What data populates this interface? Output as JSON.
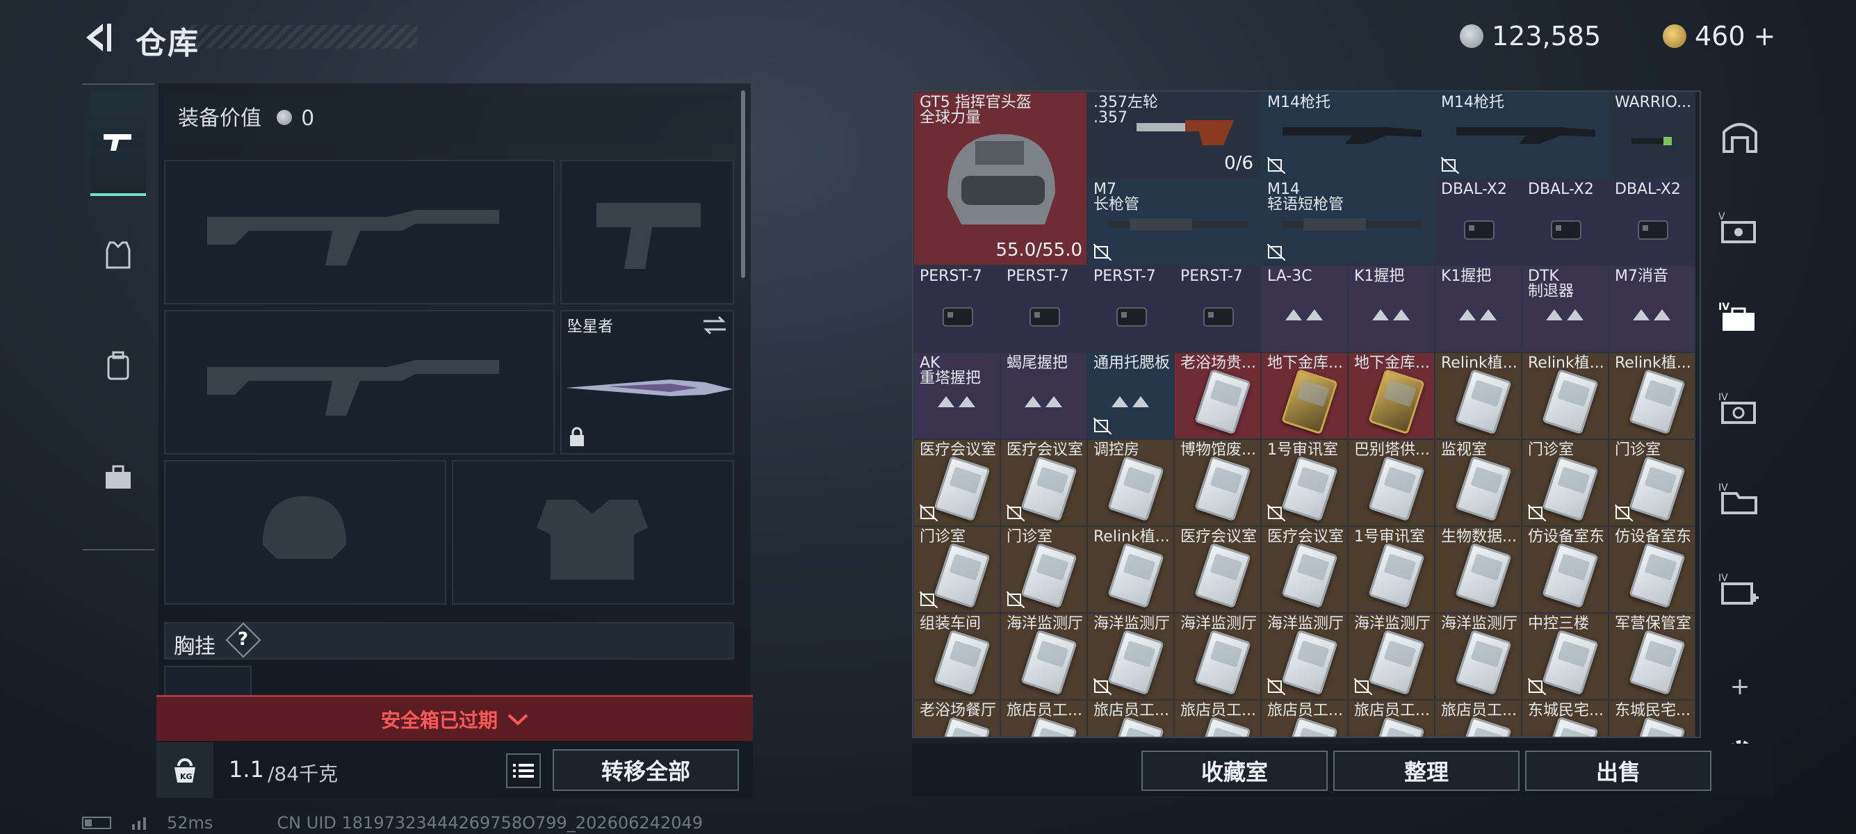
{
  "header": {
    "title": "仓库",
    "currency_silver": "123,585",
    "currency_gold": "460",
    "add_symbol": "+"
  },
  "left": {
    "equip_value_label": "装备价值",
    "equip_value": "0",
    "melee_name": "坠星者",
    "chest_label": "胸挂",
    "chest_help": "?",
    "safe_box_status": "安全箱已过期",
    "weight_current": "1.1",
    "weight_max": "/84千克",
    "transfer_all": "转移全部"
  },
  "inventory": {
    "helmet": {
      "name1": "GT5 指挥官头盔",
      "name2": "全球力量",
      "durability": "55.0/55.0"
    },
    "revolver": {
      "name1": ".357左轮",
      "name2": ".357",
      "count": "0/6"
    },
    "cells": [
      {
        "id": "m14stock1",
        "l1": "M14枪托",
        "l2": ""
      },
      {
        "id": "m14stock2",
        "l1": "M14枪托",
        "l2": ""
      },
      {
        "id": "warrior",
        "l1": "WARRIO...",
        "l2": ""
      },
      {
        "id": "m7barrel",
        "l1": "M7",
        "l2": "长枪管"
      },
      {
        "id": "m14barrel",
        "l1": "M14",
        "l2": "轻语短枪管"
      },
      {
        "id": "dbal1",
        "l1": "DBAL-X2",
        "l2": ""
      },
      {
        "id": "dbal2",
        "l1": "DBAL-X2",
        "l2": ""
      },
      {
        "id": "dbal3",
        "l1": "DBAL-X2",
        "l2": ""
      },
      {
        "id": "perst1",
        "l1": "PERST-7",
        "l2": ""
      },
      {
        "id": "perst2",
        "l1": "PERST-7",
        "l2": ""
      },
      {
        "id": "perst3",
        "l1": "PERST-7",
        "l2": ""
      },
      {
        "id": "perst4",
        "l1": "PERST-7",
        "l2": ""
      },
      {
        "id": "la3c",
        "l1": "LA-3C",
        "l2": ""
      },
      {
        "id": "k1a",
        "l1": "K1握把",
        "l2": ""
      },
      {
        "id": "k1b",
        "l1": "K1握把",
        "l2": ""
      },
      {
        "id": "dtk",
        "l1": "DTK",
        "l2": "制退器"
      },
      {
        "id": "m7sup",
        "l1": "M7消音",
        "l2": ""
      },
      {
        "id": "ak",
        "l1": "AK",
        "l2": "重塔握把"
      },
      {
        "id": "scorp",
        "l1": "蝎尾握把",
        "l2": ""
      },
      {
        "id": "buttpad",
        "l1": "通用托腮板",
        "l2": ""
      },
      {
        "id": "bath1",
        "l1": "老浴场贵...",
        "l2": ""
      },
      {
        "id": "vault1",
        "l1": "地下金库...",
        "l2": ""
      },
      {
        "id": "vault2",
        "l1": "地下金库...",
        "l2": ""
      },
      {
        "id": "relink1",
        "l1": "Relink植...",
        "l2": ""
      },
      {
        "id": "relink2",
        "l1": "Relink植...",
        "l2": ""
      },
      {
        "id": "relink3",
        "l1": "Relink植...",
        "l2": ""
      },
      {
        "id": "med1",
        "l1": "医疗会议室",
        "l2": ""
      },
      {
        "id": "med2",
        "l1": "医疗会议室",
        "l2": ""
      },
      {
        "id": "ctrl",
        "l1": "调控房",
        "l2": ""
      },
      {
        "id": "museum",
        "l1": "博物馆废...",
        "l2": ""
      },
      {
        "id": "interro1",
        "l1": "1号审讯室",
        "l2": ""
      },
      {
        "id": "babel",
        "l1": "巴别塔供...",
        "l2": ""
      },
      {
        "id": "monitor",
        "l1": "监视室",
        "l2": ""
      },
      {
        "id": "clinic1",
        "l1": "门诊室",
        "l2": ""
      },
      {
        "id": "clinic2",
        "l1": "门诊室",
        "l2": ""
      },
      {
        "id": "clinic3",
        "l1": "门诊室",
        "l2": ""
      },
      {
        "id": "clinic4",
        "l1": "门诊室",
        "l2": ""
      },
      {
        "id": "relink4",
        "l1": "Relink植...",
        "l2": ""
      },
      {
        "id": "med3",
        "l1": "医疗会议室",
        "l2": ""
      },
      {
        "id": "med4",
        "l1": "医疗会议室",
        "l2": ""
      },
      {
        "id": "interro2",
        "l1": "1号审讯室",
        "l2": ""
      },
      {
        "id": "bio",
        "l1": "生物数据...",
        "l2": ""
      },
      {
        "id": "equip1",
        "l1": "仿设备室东",
        "l2": ""
      },
      {
        "id": "equip2",
        "l1": "仿设备室东",
        "l2": ""
      },
      {
        "id": "assembly",
        "l1": "组装车间",
        "l2": ""
      },
      {
        "id": "ocean1",
        "l1": "海洋监测厅",
        "l2": ""
      },
      {
        "id": "ocean2",
        "l1": "海洋监测厅",
        "l2": ""
      },
      {
        "id": "ocean3",
        "l1": "海洋监测厅",
        "l2": ""
      },
      {
        "id": "ocean4",
        "l1": "海洋监测厅",
        "l2": ""
      },
      {
        "id": "ocean5",
        "l1": "海洋监测厅",
        "l2": ""
      },
      {
        "id": "ocean6",
        "l1": "海洋监测厅",
        "l2": ""
      },
      {
        "id": "central",
        "l1": "中控三楼",
        "l2": ""
      },
      {
        "id": "armory",
        "l1": "军营保管室",
        "l2": ""
      },
      {
        "id": "bath2",
        "l1": "老浴场餐厅",
        "l2": ""
      },
      {
        "id": "hotel1",
        "l1": "旅店员工...",
        "l2": ""
      },
      {
        "id": "hotel2",
        "l1": "旅店员工...",
        "l2": ""
      },
      {
        "id": "hotel3",
        "l1": "旅店员工...",
        "l2": ""
      },
      {
        "id": "hotel4",
        "l1": "旅店员工...",
        "l2": ""
      },
      {
        "id": "hotel5",
        "l1": "旅店员工...",
        "l2": ""
      },
      {
        "id": "hotel6",
        "l1": "旅店员工...",
        "l2": ""
      },
      {
        "id": "east1",
        "l1": "东城民宅...",
        "l2": ""
      },
      {
        "id": "east2",
        "l1": "东城民宅...",
        "l2": ""
      }
    ]
  },
  "bottom": {
    "collection": "收藏室",
    "sort": "整理",
    "sell": "出售"
  },
  "sidebar": {
    "add": "+"
  },
  "status": {
    "ping": "52ms",
    "uid": "CN UID 18197323444269758O799_202606242049"
  },
  "colors": {
    "accent": "#6fe3c5",
    "danger": "#ff5a5a",
    "red_tier": "#6e2c35",
    "gold_tier": "#4d3d2c"
  }
}
